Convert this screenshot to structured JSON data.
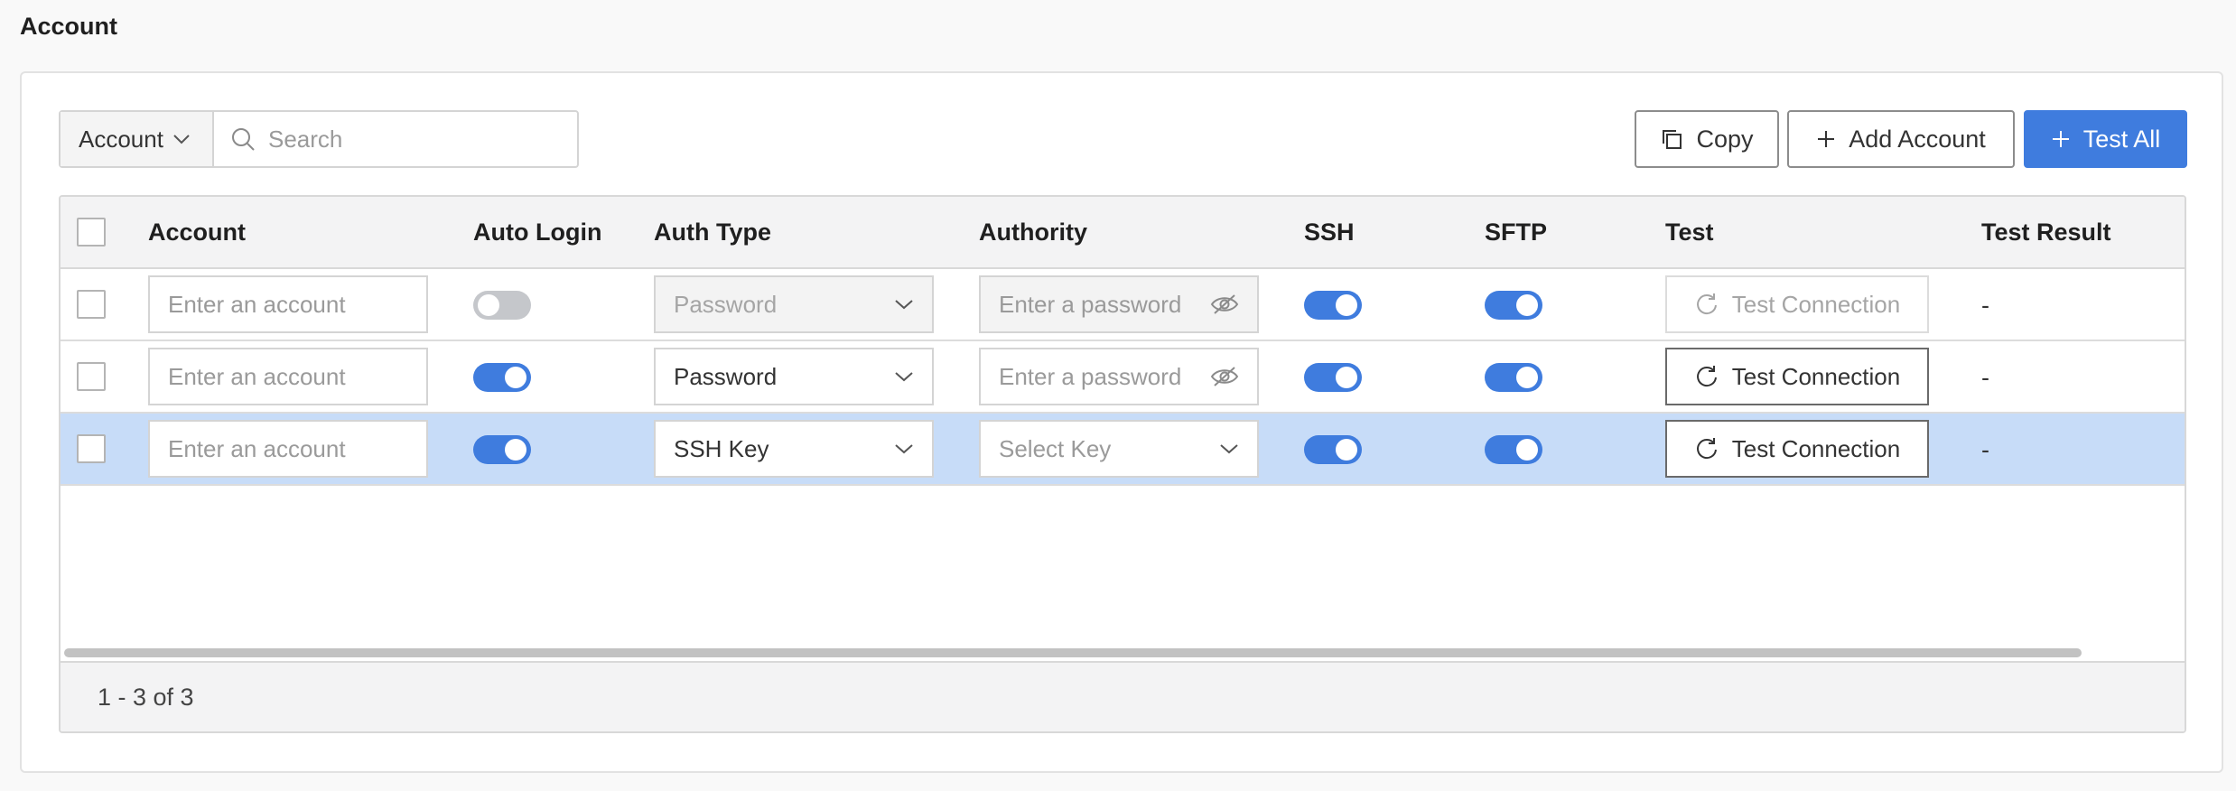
{
  "page": {
    "title": "Account"
  },
  "toolbar": {
    "field_select": "Account",
    "search_placeholder": "Search",
    "copy_label": "Copy",
    "add_label": "Add Account",
    "test_all_label": "Test All"
  },
  "table": {
    "columns": [
      "Account",
      "Auto Login",
      "Auth Type",
      "Authority",
      "SSH",
      "SFTP",
      "Test",
      "Test Result"
    ],
    "rows": [
      {
        "selected": false,
        "account_placeholder": "Enter an account",
        "auto_login": false,
        "auth_type": "Password",
        "auth_type_disabled": true,
        "authority_placeholder": "Enter a password",
        "authority_kind": "password",
        "authority_disabled": true,
        "ssh": true,
        "sftp": true,
        "test_label": "Test Connection",
        "test_disabled": true,
        "result": "-"
      },
      {
        "selected": false,
        "account_placeholder": "Enter an account",
        "auto_login": true,
        "auth_type": "Password",
        "auth_type_disabled": false,
        "authority_placeholder": "Enter a password",
        "authority_kind": "password",
        "authority_disabled": false,
        "ssh": true,
        "sftp": true,
        "test_label": "Test Connection",
        "test_disabled": false,
        "result": "-"
      },
      {
        "selected": true,
        "account_placeholder": "Enter an account",
        "auto_login": true,
        "auth_type": "SSH Key",
        "auth_type_disabled": false,
        "authority_placeholder": "Select Key",
        "authority_kind": "key",
        "authority_disabled": false,
        "ssh": true,
        "sftp": true,
        "test_label": "Test Connection",
        "test_disabled": false,
        "result": "-"
      }
    ]
  },
  "pagination": {
    "summary": "1 - 3 of 3"
  },
  "colors": {
    "primary": "#3f7cde",
    "selected_row": "#c7dcf8",
    "toggle_off": "#c5c7cb"
  }
}
